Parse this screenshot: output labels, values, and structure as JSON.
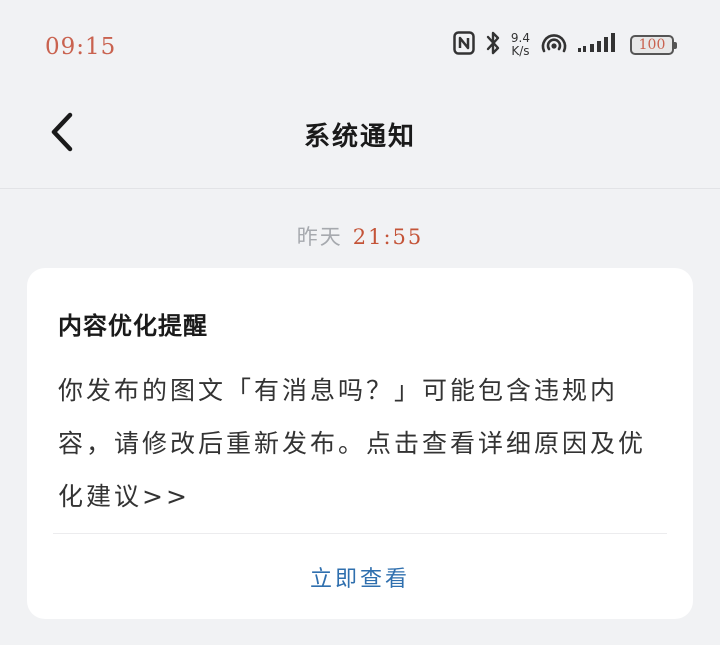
{
  "status_bar": {
    "time": "09:15",
    "network_speed_value": "9.4",
    "network_speed_unit": "K/s",
    "battery_level": "100",
    "icons": [
      "nfc-icon",
      "bluetooth-icon",
      "hotspot-icon",
      "signal-icon",
      "battery-icon"
    ]
  },
  "nav": {
    "back_icon": "chevron-left-icon",
    "title": "系统通知"
  },
  "message": {
    "date_label": "昨天",
    "time_label": "21:55",
    "card": {
      "title": "内容优化提醒",
      "body": "你发布的图文「有消息吗？」可能包含违规内容，请修改后重新发布。点击查看详细原因及优化建议>>",
      "action_label": "立即查看"
    }
  },
  "colors": {
    "background": "#f1f2f4",
    "card": "#ffffff",
    "action_link": "#2f6fae",
    "time_accent": "#c45438"
  }
}
